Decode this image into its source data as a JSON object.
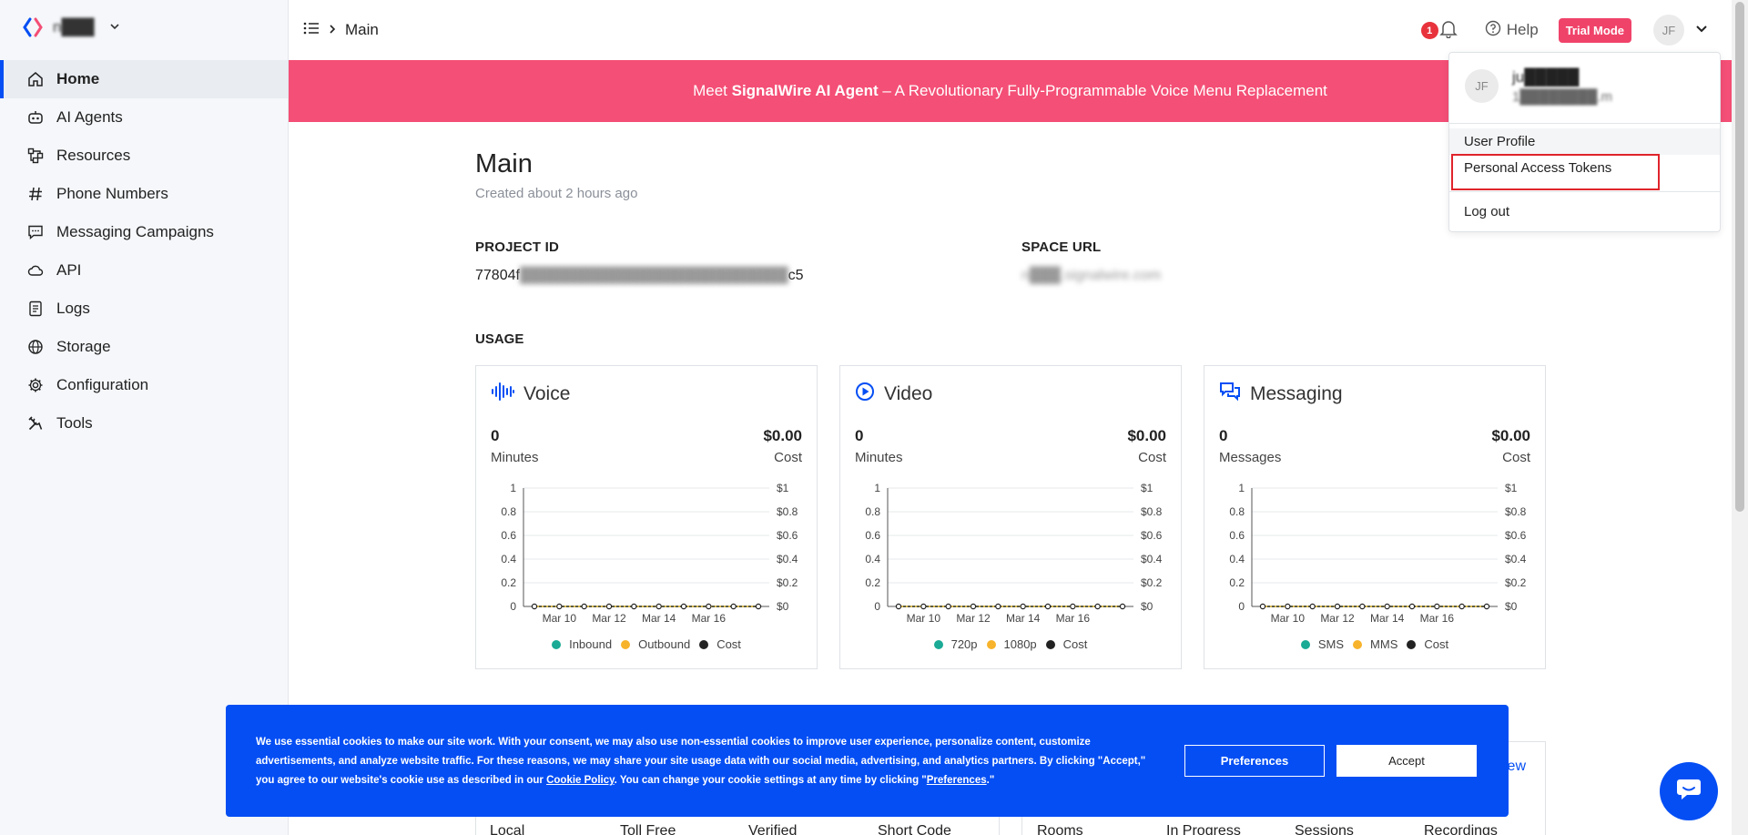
{
  "brand": {
    "name": "n███",
    "logo_icon": "signalwire-logo-icon"
  },
  "sidebar": {
    "items": [
      {
        "label": "Home",
        "icon": "home-icon",
        "active": true
      },
      {
        "label": "AI Agents",
        "icon": "robot-icon"
      },
      {
        "label": "Resources",
        "icon": "resources-icon"
      },
      {
        "label": "Phone Numbers",
        "icon": "hash-icon"
      },
      {
        "label": "Messaging Campaigns",
        "icon": "message-icon"
      },
      {
        "label": "API",
        "icon": "cloud-icon"
      },
      {
        "label": "Logs",
        "icon": "log-icon"
      },
      {
        "label": "Storage",
        "icon": "globe-icon"
      },
      {
        "label": "Configuration",
        "icon": "gear-icon"
      },
      {
        "label": "Tools",
        "icon": "tools-icon"
      }
    ]
  },
  "topbar": {
    "breadcrumb": "Main",
    "notification_count": "1",
    "help_label": "Help",
    "trial_label": "Trial Mode",
    "avatar_initials": "JF"
  },
  "banner": {
    "prefix": "Meet ",
    "bold": "SignalWire AI Agent",
    "suffix": " – A Revolutionary Fully-Programmable Voice Menu Replacement"
  },
  "main": {
    "title": "Main",
    "subtitle": "Created about 2 hours ago",
    "project_id_label": "PROJECT ID",
    "project_id_value_start": "77804f",
    "project_id_value_end": "c5",
    "space_url_label": "SPACE URL",
    "space_url_value": "n███.signalwire.com",
    "usage_label": "USAGE"
  },
  "cards": [
    {
      "title": "Voice",
      "icon": "waveform-icon",
      "left_value": "0",
      "left_label": "Minutes",
      "right_value": "$0.00",
      "right_label": "Cost",
      "legend": [
        {
          "label": "Inbound",
          "color": "#1aaa95"
        },
        {
          "label": "Outbound",
          "color": "#f7b32b"
        },
        {
          "label": "Cost",
          "color": "#222222"
        }
      ]
    },
    {
      "title": "Video",
      "icon": "play-circle-icon",
      "left_value": "0",
      "left_label": "Minutes",
      "right_value": "$0.00",
      "right_label": "Cost",
      "legend": [
        {
          "label": "720p",
          "color": "#1aaa95"
        },
        {
          "label": "1080p",
          "color": "#f7b32b"
        },
        {
          "label": "Cost",
          "color": "#222222"
        }
      ]
    },
    {
      "title": "Messaging",
      "icon": "chat-bubbles-icon",
      "left_value": "0",
      "left_label": "Messages",
      "right_value": "$0.00",
      "right_label": "Cost",
      "legend": [
        {
          "label": "SMS",
          "color": "#1aaa95"
        },
        {
          "label": "MMS",
          "color": "#f7b32b"
        },
        {
          "label": "Cost",
          "color": "#222222"
        }
      ]
    }
  ],
  "chart_data": [
    {
      "type": "line",
      "title": "Voice",
      "x": [
        "Mar 9",
        "Mar 10",
        "Mar 11",
        "Mar 12",
        "Mar 13",
        "Mar 14",
        "Mar 15",
        "Mar 16",
        "Mar 17",
        "Mar 18"
      ],
      "x_tick_labels": [
        "Mar 10",
        "Mar 12",
        "Mar 14",
        "Mar 16"
      ],
      "y_left_ticks": [
        "0",
        "0.2",
        "0.4",
        "0.6",
        "0.8",
        "1"
      ],
      "y_right_ticks": [
        "$0",
        "$0.2",
        "$0.4",
        "$0.6",
        "$0.8",
        "$1"
      ],
      "ylim": [
        0,
        1
      ],
      "series": [
        {
          "name": "Inbound",
          "values": [
            0,
            0,
            0,
            0,
            0,
            0,
            0,
            0,
            0,
            0
          ]
        },
        {
          "name": "Outbound",
          "values": [
            0,
            0,
            0,
            0,
            0,
            0,
            0,
            0,
            0,
            0
          ]
        },
        {
          "name": "Cost",
          "values": [
            0,
            0,
            0,
            0,
            0,
            0,
            0,
            0,
            0,
            0
          ]
        }
      ]
    },
    {
      "type": "line",
      "title": "Video",
      "x": [
        "Mar 9",
        "Mar 10",
        "Mar 11",
        "Mar 12",
        "Mar 13",
        "Mar 14",
        "Mar 15",
        "Mar 16",
        "Mar 17",
        "Mar 18"
      ],
      "x_tick_labels": [
        "Mar 10",
        "Mar 12",
        "Mar 14",
        "Mar 16"
      ],
      "y_left_ticks": [
        "0",
        "0.2",
        "0.4",
        "0.6",
        "0.8",
        "1"
      ],
      "y_right_ticks": [
        "$0",
        "$0.2",
        "$0.4",
        "$0.6",
        "$0.8",
        "$1"
      ],
      "ylim": [
        0,
        1
      ],
      "series": [
        {
          "name": "720p",
          "values": [
            0,
            0,
            0,
            0,
            0,
            0,
            0,
            0,
            0,
            0
          ]
        },
        {
          "name": "1080p",
          "values": [
            0,
            0,
            0,
            0,
            0,
            0,
            0,
            0,
            0,
            0
          ]
        },
        {
          "name": "Cost",
          "values": [
            0,
            0,
            0,
            0,
            0,
            0,
            0,
            0,
            0,
            0
          ]
        }
      ]
    },
    {
      "type": "line",
      "title": "Messaging",
      "x": [
        "Mar 9",
        "Mar 10",
        "Mar 11",
        "Mar 12",
        "Mar 13",
        "Mar 14",
        "Mar 15",
        "Mar 16",
        "Mar 17",
        "Mar 18"
      ],
      "x_tick_labels": [
        "Mar 10",
        "Mar 12",
        "Mar 14",
        "Mar 16"
      ],
      "y_left_ticks": [
        "0",
        "0.2",
        "0.4",
        "0.6",
        "0.8",
        "1"
      ],
      "y_right_ticks": [
        "$0",
        "$0.2",
        "$0.4",
        "$0.6",
        "$0.8",
        "$1"
      ],
      "ylim": [
        0,
        1
      ],
      "series": [
        {
          "name": "SMS",
          "values": [
            0,
            0,
            0,
            0,
            0,
            0,
            0,
            0,
            0,
            0
          ]
        },
        {
          "name": "MMS",
          "values": [
            0,
            0,
            0,
            0,
            0,
            0,
            0,
            0,
            0,
            0
          ]
        },
        {
          "name": "Cost",
          "values": [
            0,
            0,
            0,
            0,
            0,
            0,
            0,
            0,
            0,
            0
          ]
        }
      ]
    }
  ],
  "lower": {
    "left_columns": [
      "Local",
      "Toll Free",
      "Verified",
      "Short Code"
    ],
    "right_columns": [
      "Rooms",
      "In Progress",
      "Sessions",
      "Recordings"
    ],
    "view_link": "iew"
  },
  "cookie": {
    "text_1": "We use essential cookies to make our site work. With your consent, we may also use non-essential cookies to improve user experience, personalize content, customize advertisements, and analyze website traffic. For these reasons, we may share your site usage data with our social media, advertising, and analytics partners. By clicking \"Accept,\" you agree to our website's cookie use as described in our ",
    "link_1": "Cookie Policy",
    "text_2": ". You can change your cookie settings at any time by clicking \"",
    "link_2": "Preferences",
    "text_3": ".\"",
    "preferences_label": "Preferences",
    "accept_label": "Accept"
  },
  "dropdown": {
    "avatar_initials": "JF",
    "name": "ju█████",
    "email": "1████████.m",
    "items": [
      "User Profile",
      "Personal Access Tokens",
      "Log out"
    ]
  },
  "colors": {
    "accent": "#044ef4",
    "banner": "#f44f76",
    "trial": "#f0436a",
    "highlight": "#e0242b"
  }
}
